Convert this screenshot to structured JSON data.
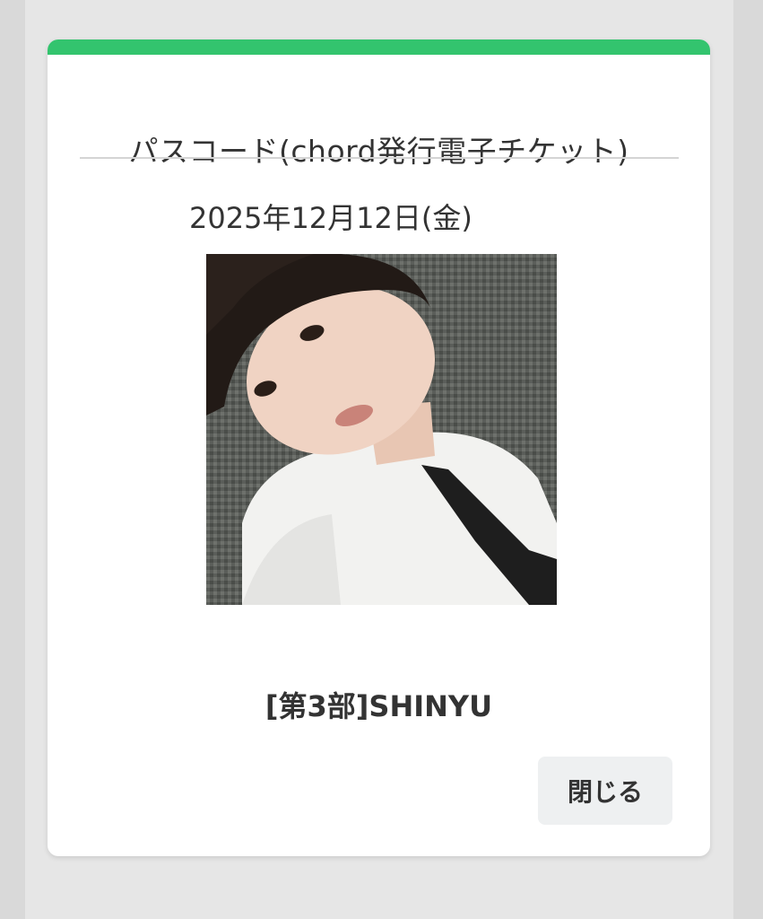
{
  "colors": {
    "accent": "#33c46e"
  },
  "modal": {
    "title": "パスコード(chord発行電子チケット)",
    "date": "2025年12月12日(金)",
    "performer": "[第3部]SHINYU",
    "close_label": "閉じる"
  }
}
